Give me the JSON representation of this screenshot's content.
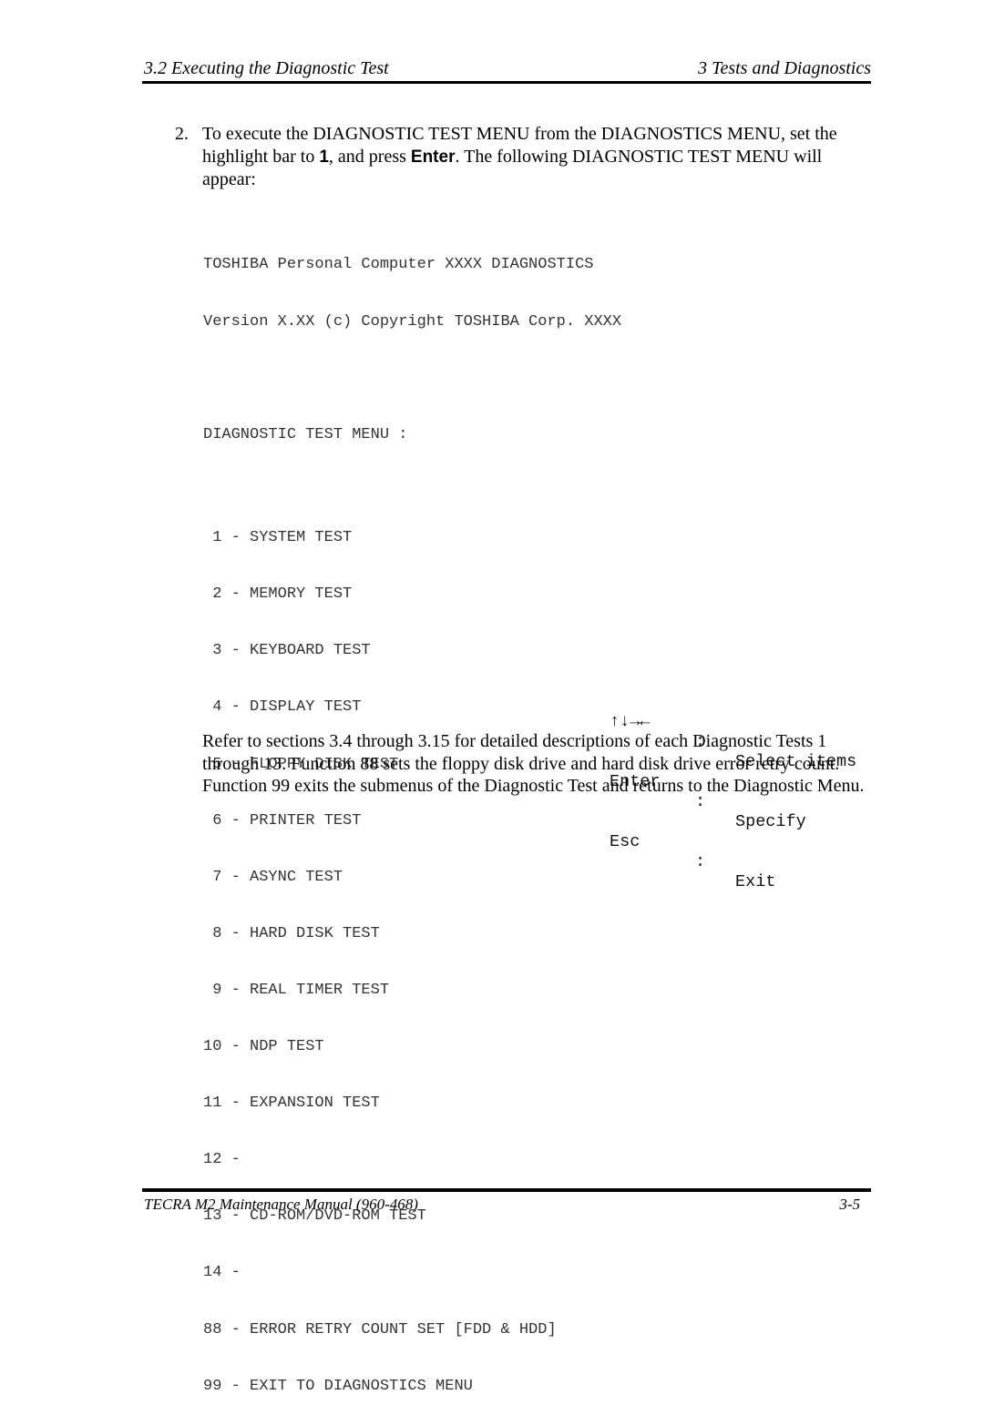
{
  "header": {
    "left": "3.2  Executing the Diagnostic Test",
    "right": "3  Tests and Diagnostics"
  },
  "step": {
    "number": "2.",
    "text_part1": "To execute the DIAGNOSTIC TEST MENU from the DIAGNOSTICS MENU, set the highlight bar to ",
    "bold1": "1",
    "text_part2": ", and press ",
    "bold2": "Enter",
    "text_part3": ". The following DIAGNOSTIC TEST MENU will appear:"
  },
  "screen": {
    "title_line1": "TOSHIBA Personal Computer XXXX DIAGNOSTICS",
    "title_line2": "Version X.XX (c) Copyright TOSHIBA Corp. XXXX",
    "menu_heading": "DIAGNOSTIC TEST MENU :",
    "items": [
      " 1 - SYSTEM TEST",
      " 2 - MEMORY TEST",
      " 3 - KEYBOARD TEST",
      " 4 - DISPLAY TEST",
      " 5 - FLOPPY DISK TEST",
      " 6 - PRINTER TEST",
      " 7 - ASYNC TEST",
      " 8 - HARD DISK TEST",
      " 9 - REAL TIMER TEST",
      "10 - NDP TEST",
      "11 - EXPANSION TEST",
      "12 -",
      "13 - CD-ROM/DVD-ROM TEST",
      "14 -",
      "88 - ERROR RETRY COUNT SET [FDD & HDD]",
      "99 - EXIT TO DIAGNOSTICS MENU"
    ]
  },
  "keys": [
    {
      "key": "↑↓→←",
      "sep": ":",
      "desc": "Select items"
    },
    {
      "key": "Enter",
      "sep": ":",
      "desc": "Specify"
    },
    {
      "key": "Esc",
      "sep": ":",
      "desc": "Exit"
    }
  ],
  "paragraph": "Refer to sections 3.4 through 3.15 for detailed descriptions of each Diagnostic Tests 1 through 13. Function 88 sets the floppy disk drive and hard disk drive error retry count. Function 99 exits the submenus of the Diagnostic Test and returns to the Diagnostic Menu.",
  "footer": {
    "left": "TECRA M2 Maintenance Manual (960-468)",
    "right": "3-5"
  }
}
